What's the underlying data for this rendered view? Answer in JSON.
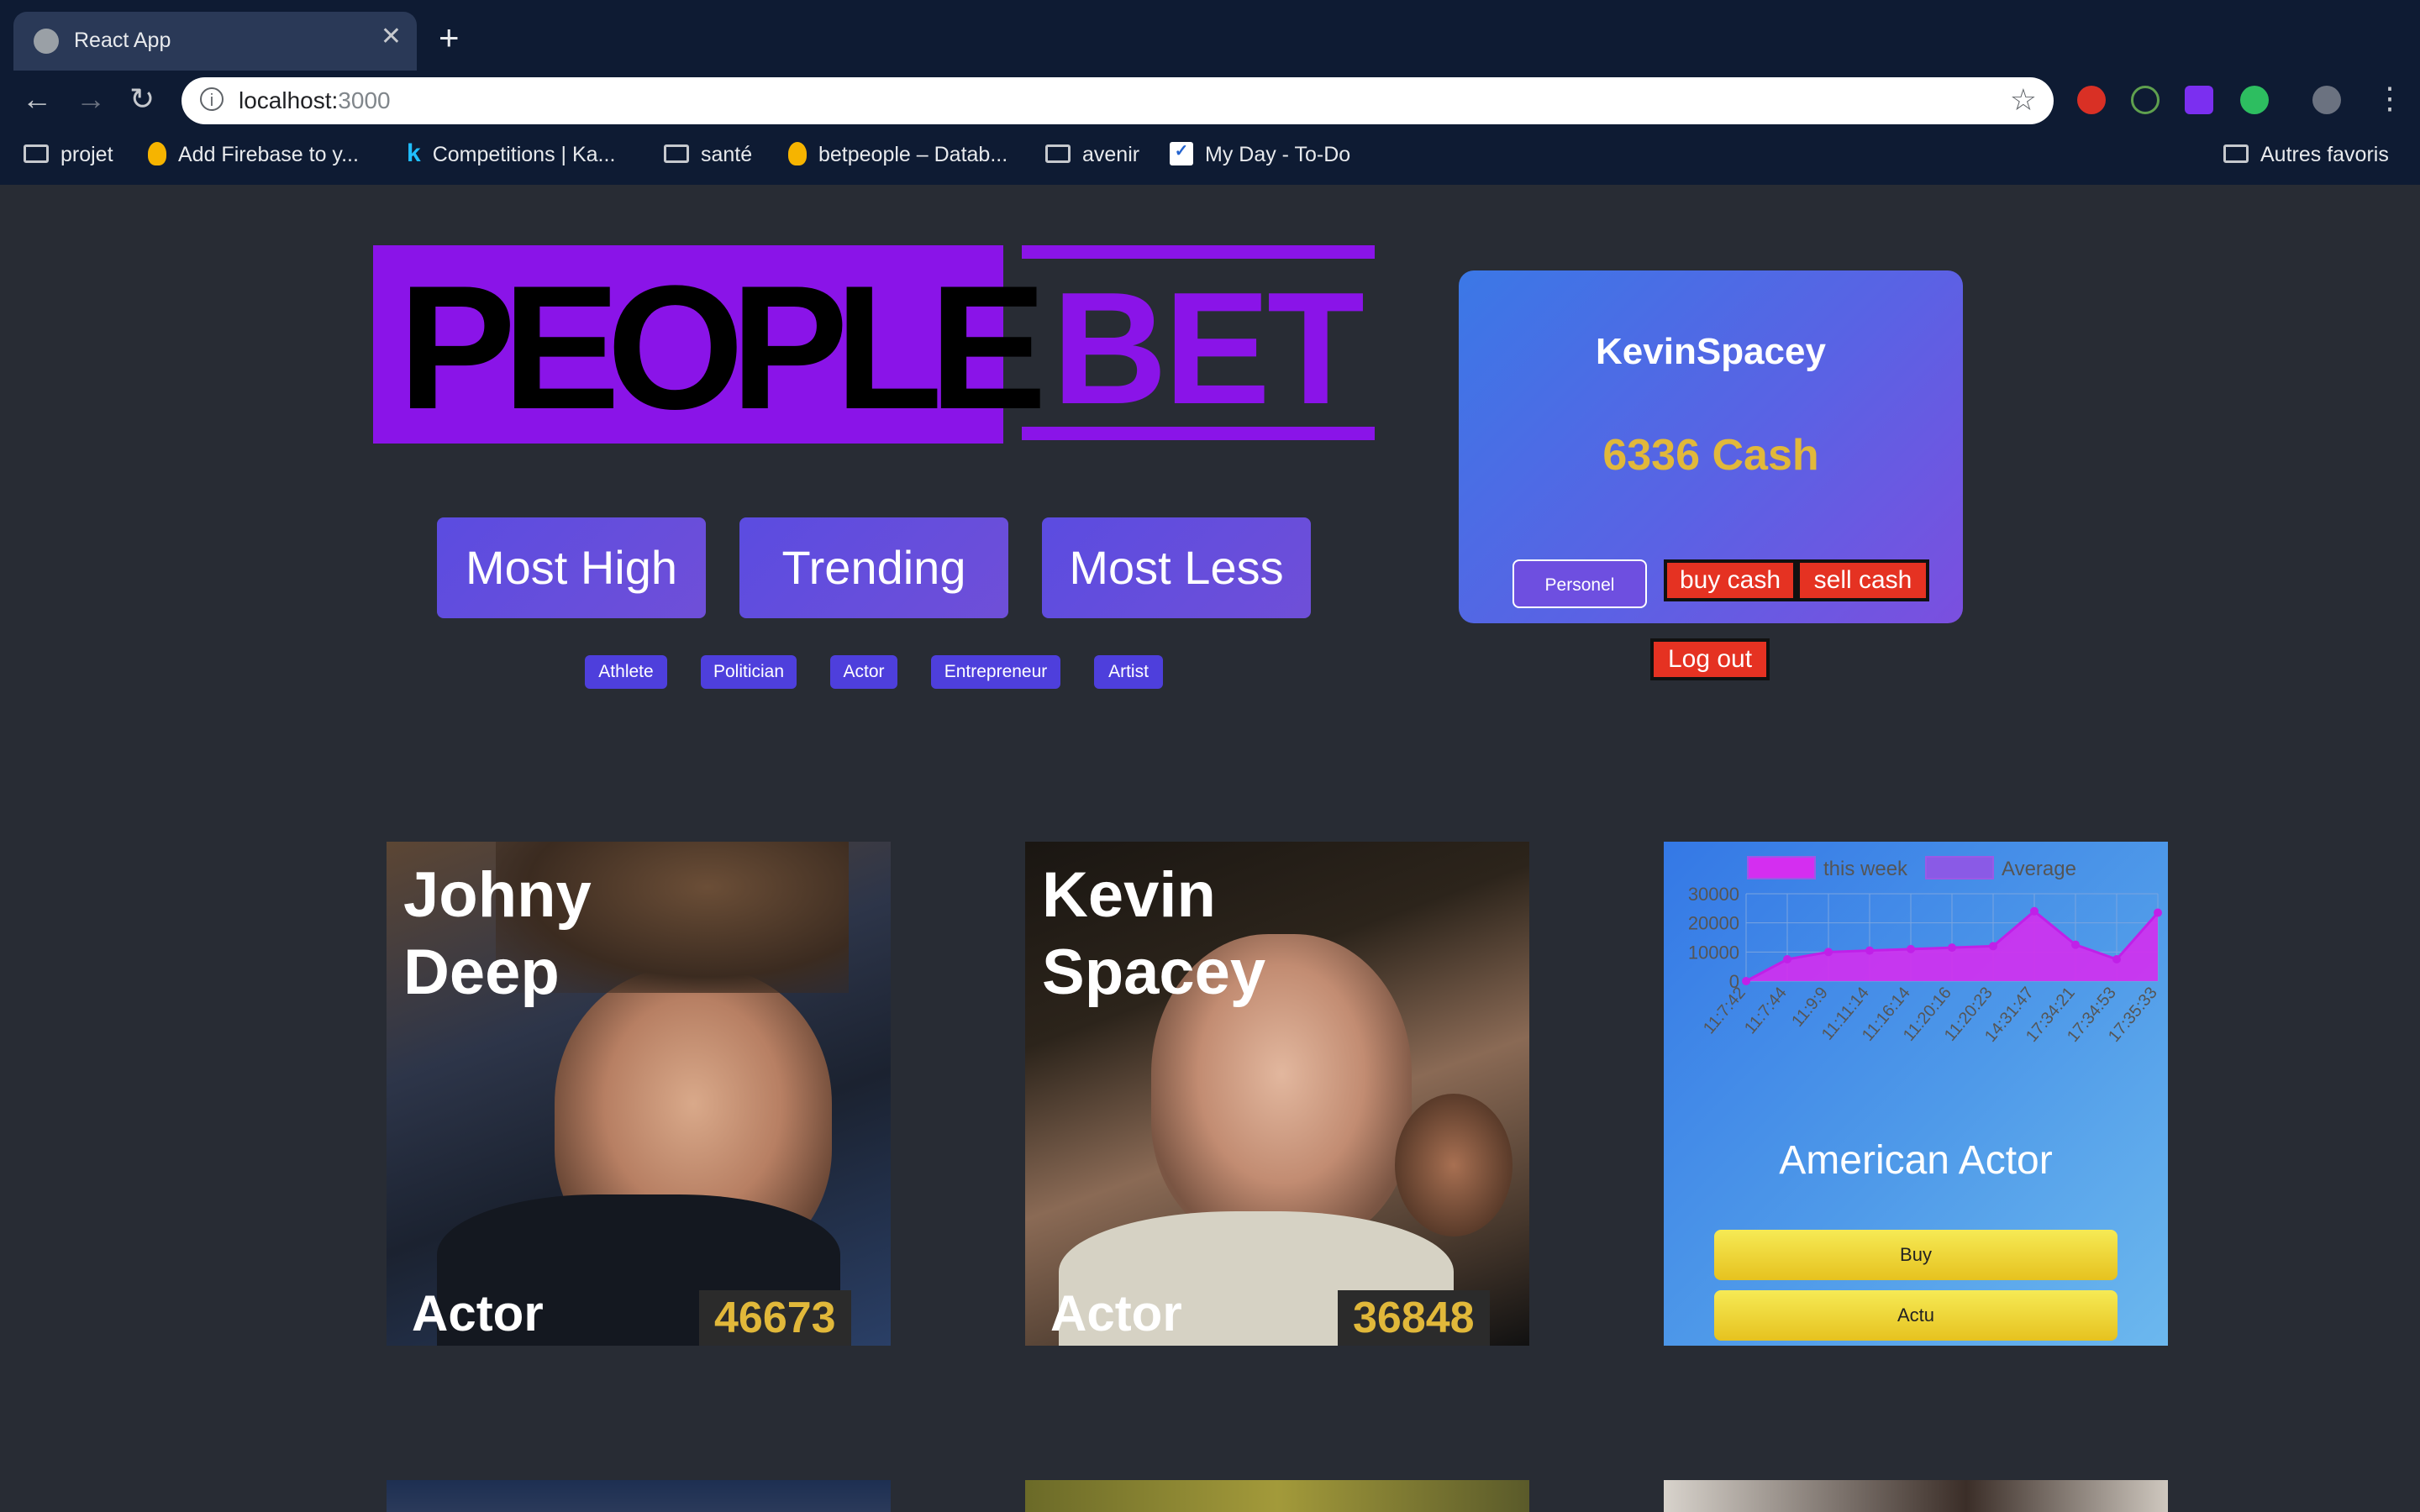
{
  "browser": {
    "tab_title": "React App",
    "tab_close": "✕",
    "new_tab": "+",
    "url_host": "localhost:",
    "url_port": "3000",
    "bookmarks": [
      "projet",
      "Add Firebase to y...",
      "Competitions | Ka...",
      "santé",
      "betpeople – Datab...",
      "avenir",
      "My Day - To-Do"
    ],
    "other_bookmarks": "Autres favoris"
  },
  "logo": {
    "left": "PEOPLE",
    "right": "BET"
  },
  "sort_buttons": [
    "Most High",
    "Trending",
    "Most Less"
  ],
  "categories": [
    "Athlete",
    "Politician",
    "Actor",
    "Entrepreneur",
    "Artist"
  ],
  "user": {
    "name": "KevinSpacey",
    "cash": "6336 Cash",
    "personel": "Personel",
    "buy_cash": "buy cash",
    "sell_cash": "sell cash",
    "logout": "Log out"
  },
  "people": [
    {
      "name_line1": "Johny",
      "name_line2": " Deep",
      "category": "Actor",
      "price": "46673"
    },
    {
      "name_line1": "Kevin",
      "name_line2": "Spacey",
      "category": "Actor",
      "price": "36848"
    }
  ],
  "detail_card": {
    "title": "American Actor",
    "buy": "Buy",
    "actu": "Actu"
  },
  "chart_data": {
    "type": "area",
    "legend": [
      "this week",
      "Average"
    ],
    "legend_placement": "top",
    "x": [
      "11:7:42",
      "11:7:44",
      "11:9:9",
      "11:11:14",
      "11:16:14",
      "11:20:16",
      "11:20:23",
      "14:31:47",
      "17:34:21",
      "17:34:53",
      "17:35:33"
    ],
    "series": [
      {
        "name": "this week",
        "values": [
          0,
          7500,
          10000,
          10500,
          11000,
          11500,
          12000,
          24000,
          12500,
          7500,
          23500
        ]
      }
    ],
    "y_ticks": [
      "30000",
      "20000",
      "10000",
      "0"
    ],
    "ylim": [
      0,
      30000
    ],
    "grid": true,
    "colors": {
      "fill": "#d42ef0",
      "line": "#c020e8",
      "avg": "#8a5ae6"
    }
  }
}
